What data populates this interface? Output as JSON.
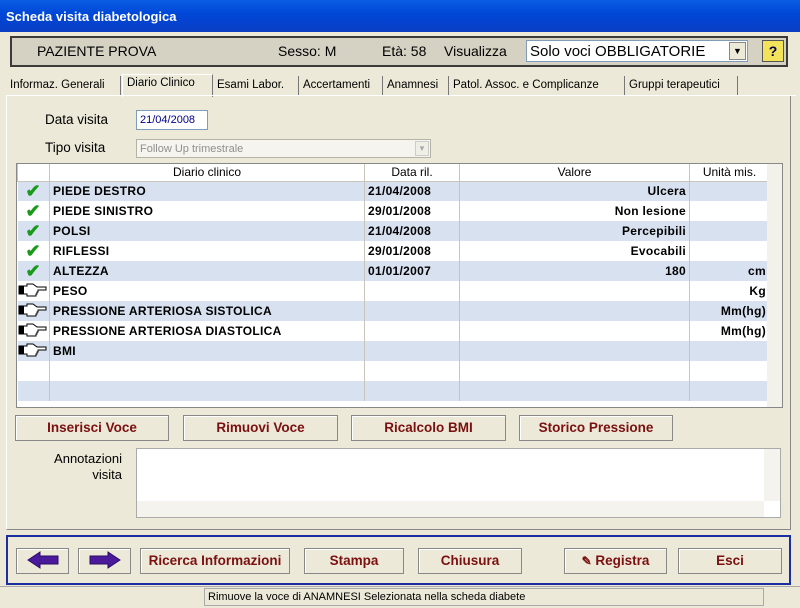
{
  "window": {
    "title": "Scheda visita diabetologica"
  },
  "patient": {
    "name": "PAZIENTE PROVA",
    "sesso": "Sesso:  M",
    "eta": "Età: 58",
    "visualizza_label": "Visualizza",
    "filter_value": "Solo voci OBBLIGATORIE",
    "help_label": "?"
  },
  "tabs": [
    {
      "label": "Informaz. Generali"
    },
    {
      "label": "Diario Clinico",
      "active": true
    },
    {
      "label": "Esami Labor."
    },
    {
      "label": "Accertamenti"
    },
    {
      "label": "Anamnesi"
    },
    {
      "label": "Patol. Assoc. e Complicanze"
    },
    {
      "label": "Gruppi terapeutici"
    }
  ],
  "visit": {
    "data_label": "Data visita",
    "data_value": "21/04/2008",
    "tipo_label": "Tipo visita",
    "tipo_value": "Follow Up trimestrale"
  },
  "grid": {
    "columns": [
      "Diario clinico",
      "Data ril.",
      "Valore",
      "Unità mis."
    ],
    "rows": [
      {
        "status": "check",
        "name": "PIEDE DESTRO",
        "date": "21/04/2008",
        "value": "Ulcera",
        "unit": ""
      },
      {
        "status": "check",
        "name": "PIEDE SINISTRO",
        "date": "29/01/2008",
        "value": "Non lesione",
        "unit": ""
      },
      {
        "status": "check",
        "name": "POLSI",
        "date": "21/04/2008",
        "value": "Percepibili",
        "unit": ""
      },
      {
        "status": "check",
        "name": "RIFLESSI",
        "date": "29/01/2008",
        "value": "Evocabili",
        "unit": ""
      },
      {
        "status": "check",
        "name": "ALTEZZA",
        "date": "01/01/2007",
        "value": "180",
        "unit": "cm"
      },
      {
        "status": "pointer",
        "name": "PESO",
        "date": "",
        "value": "",
        "unit": "Kg"
      },
      {
        "status": "pointer",
        "name": "PRESSIONE ARTERIOSA SISTOLICA",
        "date": "",
        "value": "",
        "unit": "Mm(hg)"
      },
      {
        "status": "pointer",
        "name": "PRESSIONE ARTERIOSA DIASTOLICA",
        "date": "",
        "value": "",
        "unit": "Mm(hg)"
      },
      {
        "status": "pointer",
        "name": "BMI",
        "date": "",
        "value": "",
        "unit": ""
      },
      {
        "status": "",
        "name": "",
        "date": "",
        "value": "",
        "unit": ""
      },
      {
        "status": "",
        "name": "",
        "date": "",
        "value": "",
        "unit": ""
      }
    ]
  },
  "actions": {
    "inserisci": "Inserisci Voce",
    "rimuovi": "Rimuovi Voce",
    "ricalcolo": "Ricalcolo BMI",
    "storico": "Storico Pressione"
  },
  "annotazioni": {
    "label_line1": "Annotazioni",
    "label_line2": "visita",
    "value": ""
  },
  "footer": {
    "ricerca": "Ricerca Informazioni",
    "stampa": "Stampa",
    "chiusura": "Chiusura",
    "registra": "Registra",
    "esci": "Esci"
  },
  "status": {
    "message": "Rimuove la voce di ANAMNESI Selezionata nella scheda diabete"
  },
  "colors": {
    "titlebar": "#0046d6",
    "button_text": "#7a1010",
    "row_alt": "#d7e1ef",
    "check": "#1a9a1a"
  }
}
